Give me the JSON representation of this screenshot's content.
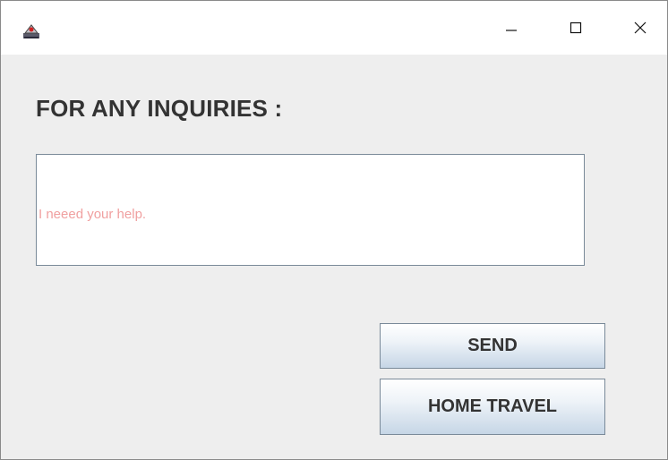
{
  "window": {
    "icon": "java-app-icon",
    "controls": {
      "minimize_icon": "minimize-icon",
      "maximize_icon": "maximize-icon",
      "close_icon": "close-icon"
    }
  },
  "main": {
    "heading": "FOR ANY INQUIRIES :",
    "inquiry_text": "I neeed your help.",
    "send_label": "SEND",
    "home_travel_label": "HOME TRAVEL"
  },
  "colors": {
    "background": "#eeeeee",
    "inquiry_text": "#f0a0a0",
    "heading_text": "#333333"
  }
}
